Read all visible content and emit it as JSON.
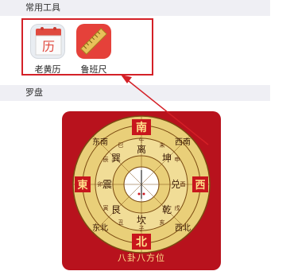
{
  "sections": {
    "tools_title": "常用工具",
    "luopan_title": "罗盘"
  },
  "tools": [
    {
      "label": "老黄历",
      "icon_char": "历",
      "icon": "calendar-icon"
    },
    {
      "label": "鲁班尺",
      "icon": "ruler-icon"
    }
  ],
  "luopan": {
    "caption": "八卦八方位",
    "dir_south": "南",
    "dir_north": "北",
    "dir_east": "東",
    "dir_west": "西",
    "trigrams": [
      "离",
      "坤",
      "兑",
      "乾",
      "坎",
      "艮",
      "震",
      "巽"
    ],
    "sub_dirs": [
      "西南",
      "西北",
      "东北",
      "东南"
    ],
    "outer_marks": [
      "午",
      "未",
      "申",
      "酉",
      "戌",
      "亥",
      "子",
      "丑",
      "寅",
      "卯",
      "辰",
      "巳"
    ]
  },
  "colors": {
    "highlight_border": "#d42027",
    "card_red": "#b8121d",
    "gold": "#e9cf79",
    "arrow": "#d42027"
  }
}
